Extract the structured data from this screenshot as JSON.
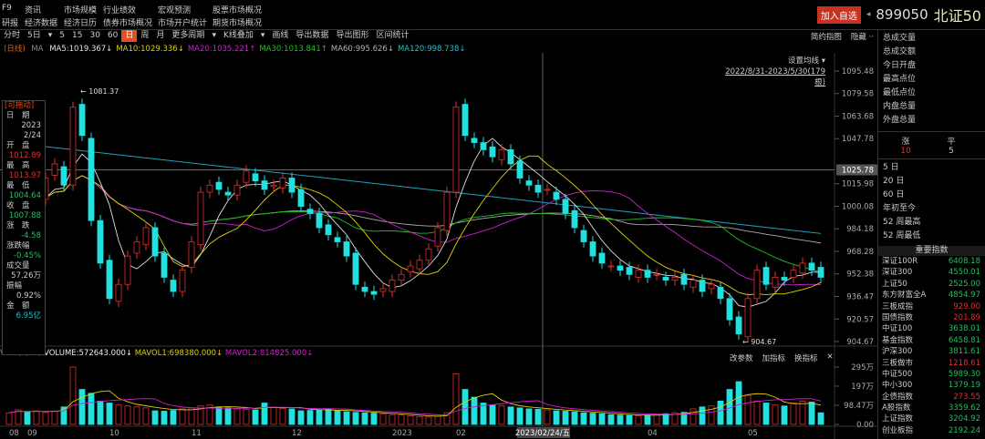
{
  "menu": {
    "row1": [
      "F9",
      "资讯",
      "市场规模",
      "行业绩效",
      "宏观预测",
      "股票市场概况"
    ],
    "row2": [
      "研报",
      "经济数据",
      "经济日历",
      "债券市场概况",
      "市场开户统计",
      "期货市场概况"
    ]
  },
  "title": {
    "add_watch": "加入自选",
    "arrow": "◂",
    "code": "899050",
    "name": "北证50"
  },
  "toolbar": {
    "items": [
      "分时",
      "5日",
      "▾",
      "5",
      "15",
      "30",
      "60",
      "日",
      "周",
      "月",
      "更多周期",
      "▾",
      "K线叠加",
      "▾",
      "画线",
      "导出数据",
      "导出图形",
      "区间统计"
    ],
    "active_index": 7,
    "right": [
      "简约指图",
      "隐藏 ··"
    ]
  },
  "ma_legend": {
    "prefix": "(日线)",
    "ma": "MA",
    "items": [
      {
        "t": "MA5:1019.367↓",
        "c": "#e0e0e0"
      },
      {
        "t": "MA10:1029.336↓",
        "c": "#e0d000"
      },
      {
        "t": "MA20:1035.221↑",
        "c": "#d020d0"
      },
      {
        "t": "MA30:1013.841↑",
        "c": "#20c020"
      },
      {
        "t": "MA60:995.626↓",
        "c": "#b0b0b0"
      },
      {
        "t": "MA120:998.738↓",
        "c": "#20c0d0"
      }
    ]
  },
  "chart_overlay": {
    "set_ma": "设置均线 ▾",
    "range": "2022/8/31-2023/5/30(179根)",
    "high_label": "1081.37",
    "low_label": "904.67",
    "crosshair_price": "1025.78",
    "crosshair_date": "2023/02/24/五"
  },
  "info_box": {
    "title": "[可拖动]",
    "rows": [
      [
        "日　期",
        ""
      ],
      [
        "",
        "2023"
      ],
      [
        "",
        "2/24"
      ],
      [
        "开　盘",
        ""
      ],
      [
        "",
        "1012.89"
      ],
      [
        "最　高",
        ""
      ],
      [
        "",
        "1013.97"
      ],
      [
        "最　低",
        ""
      ],
      [
        "",
        "1004.64"
      ],
      [
        "收　盘",
        ""
      ],
      [
        "",
        "1007.88"
      ],
      [
        "涨　跌",
        ""
      ],
      [
        "",
        "-4.58"
      ],
      [
        "涨跌幅",
        ""
      ],
      [
        "",
        "-0.45%"
      ],
      [
        "成交量",
        ""
      ],
      [
        "",
        "57.26万"
      ],
      [
        "振幅",
        ""
      ],
      [
        "",
        "0.92%"
      ],
      [
        "金　额",
        ""
      ],
      [
        "",
        "6.95亿"
      ]
    ]
  },
  "vol_legend": {
    "prefix": "VOL (5,10)",
    "volume": "VOLUME:572643.000↓",
    "mavol1": "MAVOL1:698380.000↓",
    "mavol2": "MAVOL2:814825.000↓"
  },
  "vol_buttons": [
    "改参数",
    "加指标",
    "换指标",
    "✕"
  ],
  "right_panel": {
    "stats": [
      "总成交量",
      "总成交额",
      "今日开盘",
      "最高点位",
      "最低点位",
      "内盘总量",
      "外盘总量"
    ],
    "up_label": "涨",
    "flat_label": "平",
    "up_count": "10",
    "flat_count": "5",
    "periods": [
      "5 日",
      "20 日",
      "60 日",
      "年初至今",
      "52 周最高",
      "52 周最低"
    ],
    "index_title": "重要指数",
    "indices": [
      {
        "n": "深证100R",
        "v": "6408.18",
        "d": "dn"
      },
      {
        "n": "深证300",
        "v": "4550.01",
        "d": "dn"
      },
      {
        "n": "上证50",
        "v": "2525.00",
        "d": "dn"
      },
      {
        "n": "东方财富全A",
        "v": "4854.97",
        "d": "dn"
      },
      {
        "n": "三板成指",
        "v": "929.00",
        "d": "up"
      },
      {
        "n": "国债指数",
        "v": "201.89",
        "d": "up"
      },
      {
        "n": "中证100",
        "v": "3638.01",
        "d": "dn"
      },
      {
        "n": "基金指数",
        "v": "6458.81",
        "d": "dn"
      },
      {
        "n": "沪深300",
        "v": "3811.61",
        "d": "dn"
      },
      {
        "n": "三板做市",
        "v": "1218.61",
        "d": "up"
      },
      {
        "n": "中证500",
        "v": "5989.30",
        "d": "dn"
      },
      {
        "n": "中小300",
        "v": "1379.19",
        "d": "dn"
      },
      {
        "n": "企债指数",
        "v": "273.55",
        "d": "up"
      },
      {
        "n": "A股指数",
        "v": "3359.62",
        "d": "dn"
      },
      {
        "n": "上证指数",
        "v": "3204.92",
        "d": "dn"
      },
      {
        "n": "创业板指",
        "v": "2192.24",
        "d": "dn"
      }
    ]
  },
  "chart_data": {
    "type": "candlestick",
    "price_ticks": [
      "1095.48",
      "1079.58",
      "1063.68",
      "1047.78",
      "1015.98",
      "1000.08",
      "984.18",
      "968.28",
      "952.38",
      "936.47",
      "920.57",
      "904.67"
    ],
    "ylim": [
      904.67,
      1095.48
    ],
    "vol_ticks": [
      "295万",
      "197万",
      "98.47万",
      "0.00"
    ],
    "vol_max": 295,
    "x_labels": [
      {
        "t": "08",
        "i": 0
      },
      {
        "t": "09",
        "i": 2
      },
      {
        "t": "10",
        "i": 11
      },
      {
        "t": "11",
        "i": 20
      },
      {
        "t": "12",
        "i": 31
      },
      {
        "t": "2023",
        "i": 42
      },
      {
        "t": "02",
        "i": 49
      },
      {
        "t": "03",
        "i": 59
      },
      {
        "t": "04",
        "i": 70
      },
      {
        "t": "05",
        "i": 81
      }
    ],
    "close": [
      1000,
      1010,
      995,
      1005,
      1020,
      1030,
      1015,
      1070,
      1050,
      990,
      960,
      935,
      945,
      965,
      975,
      985,
      965,
      950,
      940,
      955,
      975,
      1010,
      1015,
      1012,
      1008,
      1015,
      1025,
      1018,
      1012,
      1015,
      1020,
      1010,
      1000,
      995,
      985,
      980,
      975,
      965,
      945,
      940,
      938,
      942,
      948,
      952,
      958,
      962,
      970,
      985,
      1010,
      1070,
      1050,
      1045,
      1040,
      1035,
      1040,
      1030,
      1020,
      1015,
      1010,
      1012,
      1005,
      995,
      985,
      975,
      965,
      960,
      958,
      955,
      952,
      955,
      950,
      952,
      948,
      950,
      945,
      948,
      940,
      945,
      935,
      920,
      910,
      935,
      955,
      945,
      950,
      948,
      955,
      960,
      955,
      950
    ],
    "volume": [
      60,
      75,
      65,
      70,
      62,
      68,
      90,
      295,
      180,
      160,
      120,
      110,
      100,
      95,
      90,
      85,
      70,
      68,
      72,
      80,
      85,
      95,
      100,
      90,
      85,
      80,
      78,
      75,
      110,
      88,
      82,
      80,
      70,
      72,
      75,
      78,
      70,
      65,
      62,
      60,
      58,
      55,
      50,
      48,
      45,
      40,
      38,
      42,
      60,
      260,
      180,
      140,
      110,
      100,
      95,
      90,
      85,
      80,
      78,
      75,
      70,
      68,
      65,
      60,
      58,
      55,
      50,
      48,
      46,
      45,
      48,
      52,
      55,
      60,
      62,
      80,
      90,
      95,
      120,
      180,
      220,
      150,
      120,
      110,
      100,
      95,
      110,
      120,
      115,
      60
    ]
  }
}
